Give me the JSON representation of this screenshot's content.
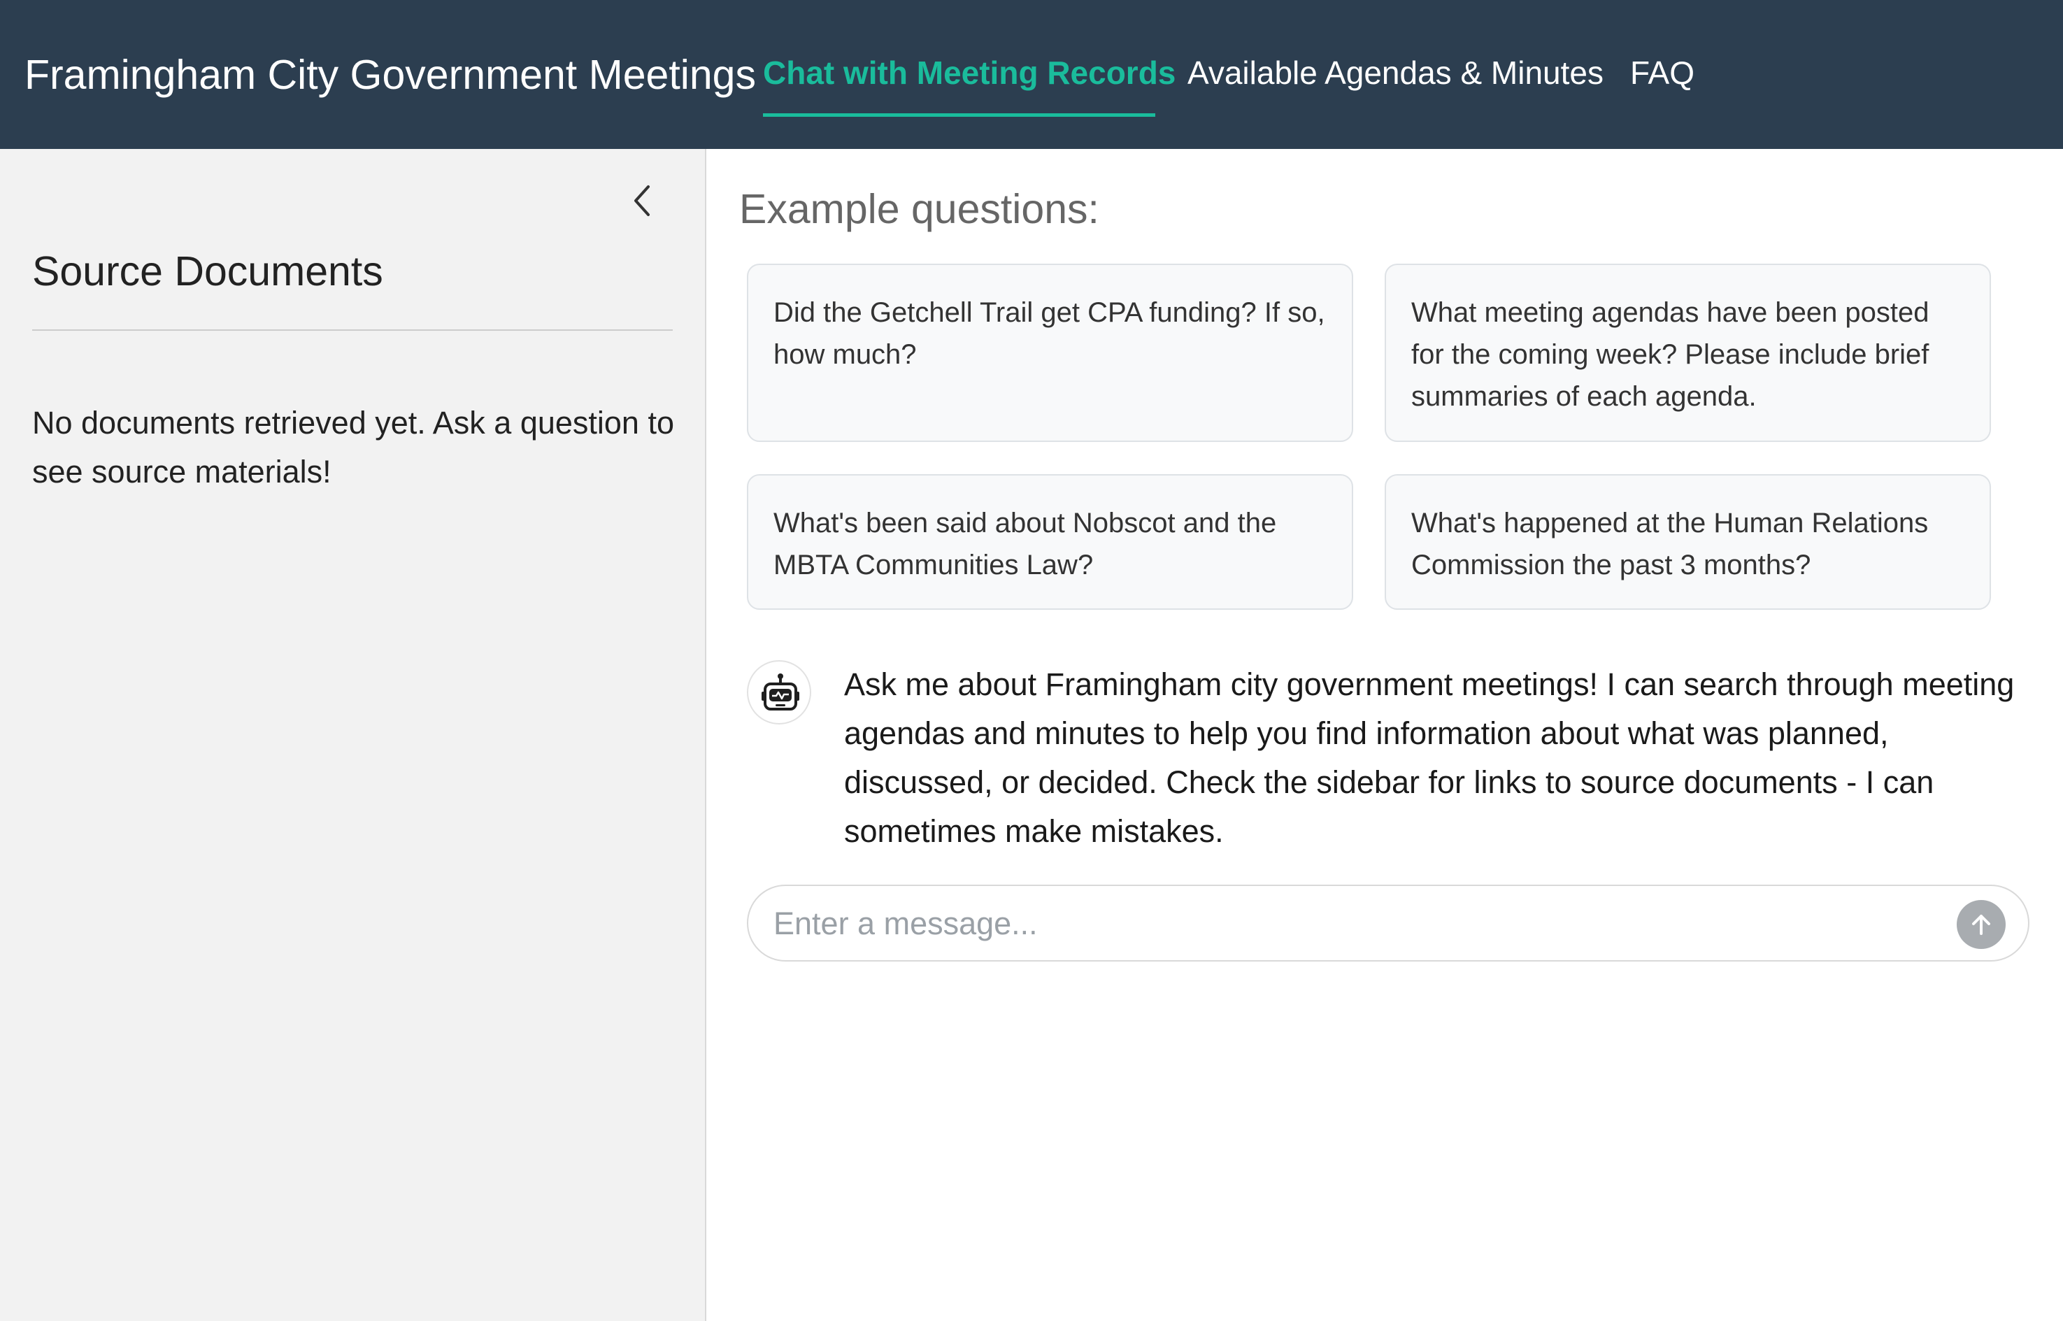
{
  "app": {
    "title": "Framingham City Government Meetings"
  },
  "nav": {
    "items": [
      {
        "label": "Chat with Meeting Records",
        "active": true
      },
      {
        "label": "Available Agendas & Minutes",
        "active": false
      },
      {
        "label": "FAQ",
        "active": false
      }
    ]
  },
  "sidebar": {
    "collapse_icon": "chevron-left-icon",
    "title": "Source Documents",
    "empty_message": "No documents retrieved yet. Ask a question to see source materials!"
  },
  "main": {
    "examples_heading": "Example questions:",
    "examples": [
      "Did the Getchell Trail get CPA funding? If so, how much?",
      "What meeting agendas have been posted for the coming week? Please include brief summaries of each agenda.",
      "What's been said about Nobscot and the MBTA Communities Law?",
      "What's happened at the Human Relations Commission the past 3 months?"
    ],
    "bot_avatar_icon": "robot-icon",
    "bot_message": "Ask me about Framingham city government meetings! I can search through meeting agendas and minutes to help you find information about what was planned, discussed, or decided. Check the sidebar for links to source documents - I can sometimes make mistakes.",
    "input": {
      "placeholder": "Enter a message...",
      "value": ""
    },
    "send_icon": "arrow-up-icon"
  },
  "colors": {
    "navbar_bg": "#2c3e50",
    "accent": "#1abc9c",
    "sidebar_bg": "#f2f2f2",
    "card_bg": "#f8f9fa",
    "send_button": "#a8acb0"
  }
}
